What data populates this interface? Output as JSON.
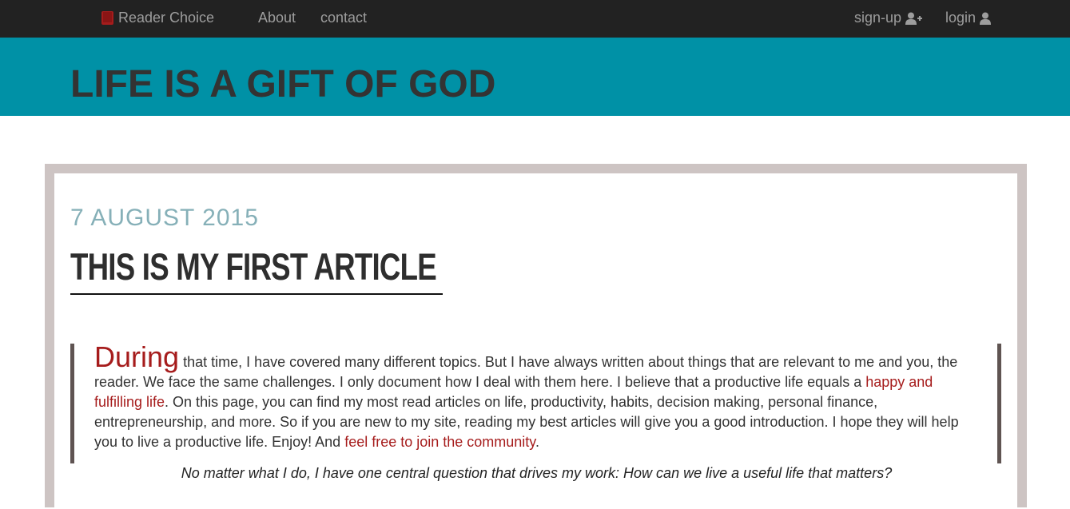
{
  "navbar": {
    "brand": "Reader Choice",
    "brand_icon": "book-icon",
    "links": [
      "About",
      "contact"
    ],
    "signup_label": "sign-up",
    "signup_icon": "user-plus-icon",
    "login_label": "login",
    "login_icon": "user-icon"
  },
  "banner": {
    "title": "LIFE IS A GIFT OF GOD",
    "background": "#0091a6"
  },
  "post": {
    "date": "7 AUGUST 2015",
    "title": "THIS IS MY FIRST ARTICLE",
    "dropcap": "During",
    "text_1": " that time, I have covered many different topics. But I have always written about things that are relevant to me and you, the reader. We face the same challenges. I only document how I deal with them here. I believe that a productive life equals a ",
    "link_1": "happy and fulfilling life",
    "text_2": ". On this page, you can find my most read articles on life, productivity, habits, decision making, personal finance, entrepreneurship, and more. So if you are new to my site, reading my best articles will give you a good introduction. I hope they will help you to live a productive life. Enjoy! And ",
    "link_2": "feel free to join the community",
    "text_3": ".",
    "closing_quote": "No matter what I do, I have one central question that drives my work: How can we live a useful life that matters?"
  },
  "colors": {
    "navbar": "#222222",
    "accent_link": "#a61c1c",
    "date": "#86b0b8",
    "frame": "#cdc4c3"
  }
}
